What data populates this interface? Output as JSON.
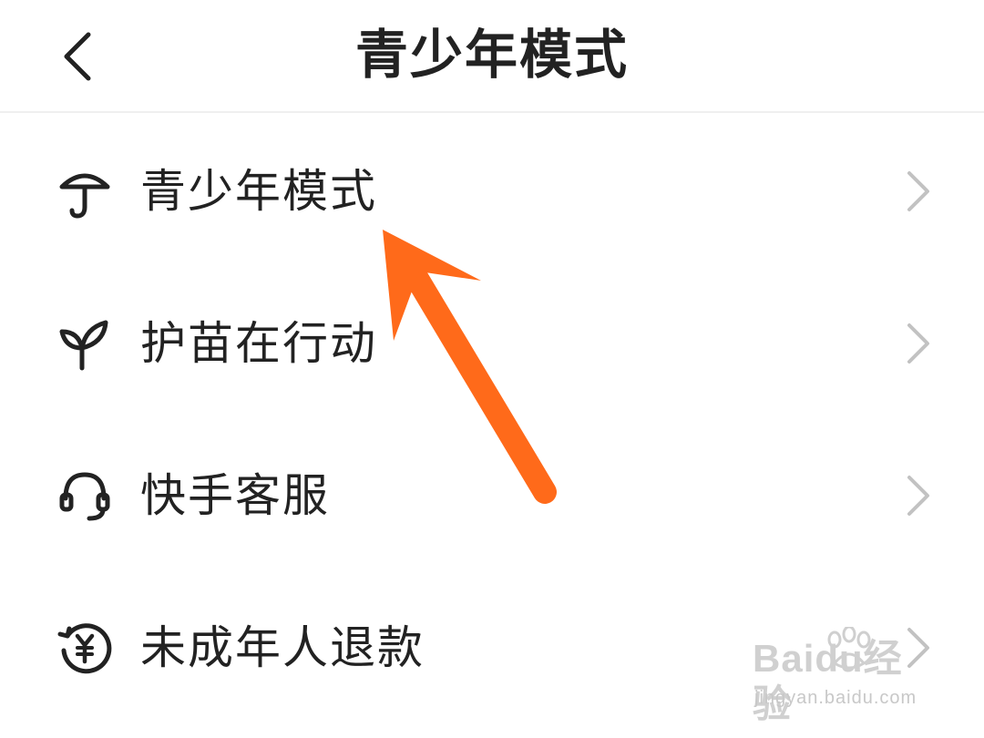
{
  "header": {
    "title": "青少年模式"
  },
  "menu": [
    {
      "label": "青少年模式",
      "icon": "umbrella-icon"
    },
    {
      "label": "护苗在行动",
      "icon": "sprout-icon"
    },
    {
      "label": "快手客服",
      "icon": "headset-icon"
    },
    {
      "label": "未成年人退款",
      "icon": "refund-yen-icon"
    }
  ],
  "annotation": {
    "color": "#FF6A1A"
  },
  "watermark": {
    "logo": "Baidu经验",
    "url": "jingyan.baidu.com"
  }
}
